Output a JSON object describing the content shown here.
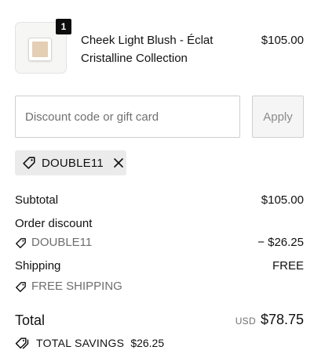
{
  "product": {
    "name": "Cheek Light Blush - Éclat Cristalline Collection",
    "price": "$105.00",
    "quantity": "1",
    "icon": "blush-compact-thumbnail"
  },
  "discount_form": {
    "placeholder": "Discount code or gift card",
    "value": "",
    "apply_label": "Apply"
  },
  "applied_code": {
    "code": "DOUBLE11",
    "icon": "tag-icon",
    "remove_icon": "close-icon"
  },
  "summary": {
    "subtotal_label": "Subtotal",
    "subtotal_value": "$105.00",
    "order_discount_label": "Order discount",
    "discount_code": "DOUBLE11",
    "discount_value": "− $26.25",
    "shipping_label": "Shipping",
    "shipping_value": "FREE",
    "shipping_code": "FREE SHIPPING",
    "total_label": "Total",
    "currency": "USD",
    "total_value": "$78.75",
    "savings_label": "TOTAL SAVINGS",
    "savings_value": "$26.25"
  },
  "colors": {
    "text": "#111111",
    "muted": "#6e6e6e",
    "chip_bg": "#ebebeb",
    "badge_bg": "#0d0d0d",
    "border": "#cfcfcf"
  }
}
